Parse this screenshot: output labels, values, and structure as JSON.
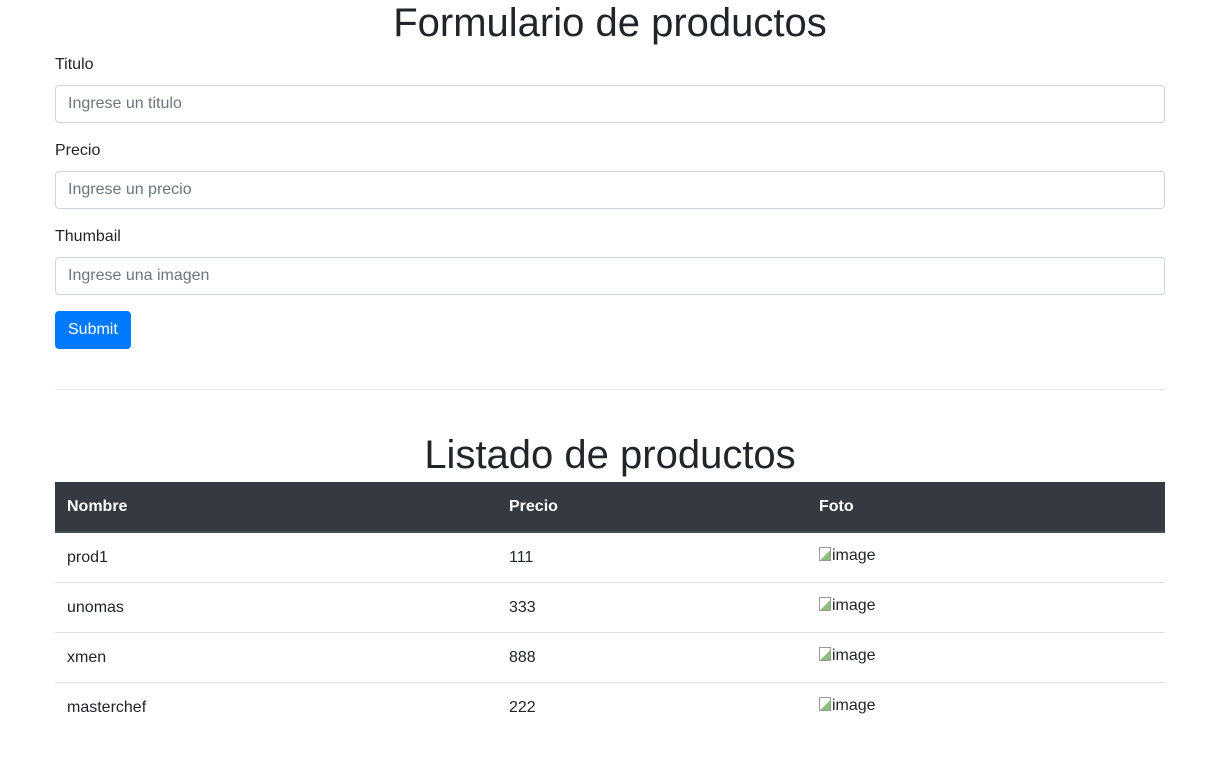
{
  "form": {
    "title": "Formulario de productos",
    "fields": [
      {
        "label": "Titulo",
        "placeholder": "Ingrese un titulo",
        "value": ""
      },
      {
        "label": "Precio",
        "placeholder": "Ingrese un precio",
        "value": ""
      },
      {
        "label": "Thumbail",
        "placeholder": "Ingrese una imagen",
        "value": ""
      }
    ],
    "submit_label": "Submit"
  },
  "listing": {
    "title": "Listado de productos",
    "columns": [
      "Nombre",
      "Precio",
      "Foto"
    ],
    "rows": [
      {
        "nombre": "prod1",
        "precio": "111",
        "foto_alt": "image"
      },
      {
        "nombre": "unomas",
        "precio": "333",
        "foto_alt": "image"
      },
      {
        "nombre": "xmen",
        "precio": "888",
        "foto_alt": "image"
      },
      {
        "nombre": "masterchef",
        "precio": "222",
        "foto_alt": "image"
      }
    ]
  },
  "colors": {
    "primary": "#007bff",
    "table_header_bg": "#343a40",
    "text": "#212529"
  }
}
